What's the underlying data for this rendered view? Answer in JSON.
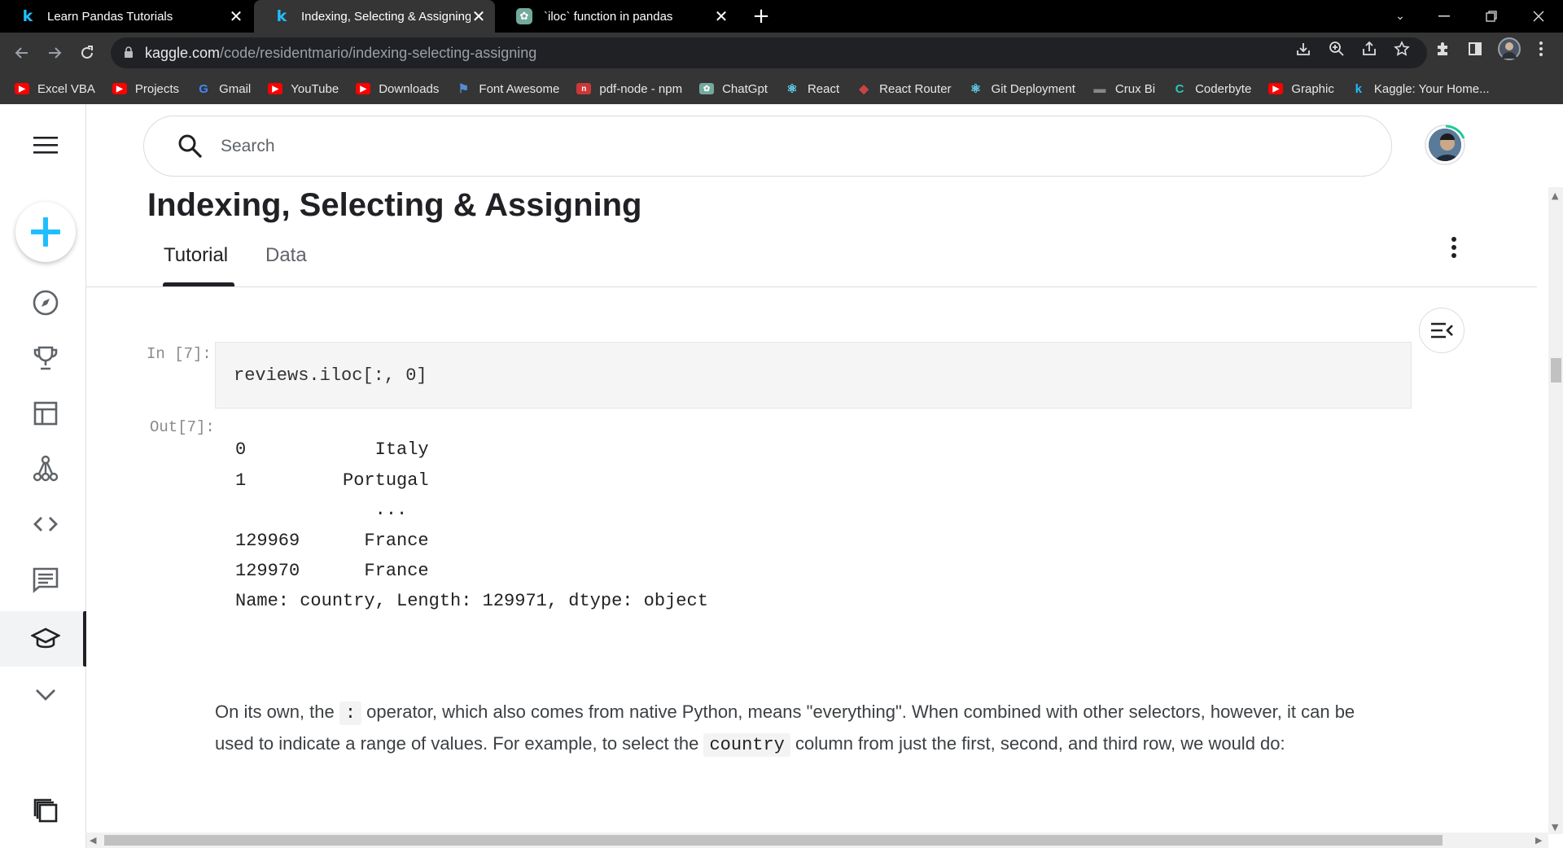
{
  "browser": {
    "tabs": [
      {
        "title": "Learn Pandas Tutorials",
        "close": "✕",
        "icon": "kaggle-icon"
      },
      {
        "title": "Indexing, Selecting & Assigning |",
        "close": "✕",
        "icon": "kaggle-icon"
      },
      {
        "title": "`iloc` function in pandas",
        "close": "✕",
        "icon": "chatgpt-icon"
      }
    ],
    "new_tab": "+",
    "url_domain": "kaggle.com",
    "url_path": "/code/residentmario/indexing-selecting-assigning",
    "bookmarks": [
      {
        "label": "Excel VBA",
        "color": "#ff0000",
        "icon": "youtube-icon"
      },
      {
        "label": "Projects",
        "color": "#ff0000",
        "icon": "youtube-icon"
      },
      {
        "label": "Gmail",
        "color": "#4285f4",
        "icon": "google-icon"
      },
      {
        "label": "YouTube",
        "color": "#ff0000",
        "icon": "youtube-icon"
      },
      {
        "label": "Downloads",
        "color": "#ff0000",
        "icon": "youtube-icon"
      },
      {
        "label": "Font Awesome",
        "color": "#538dd7",
        "icon": "flag-icon"
      },
      {
        "label": "pdf-node - npm",
        "color": "#cb3837",
        "icon": "npm-icon"
      },
      {
        "label": "ChatGpt",
        "color": "#74aa9c",
        "icon": "chatgpt-icon"
      },
      {
        "label": "React",
        "color": "#61dafb",
        "icon": "react-icon"
      },
      {
        "label": "React Router",
        "color": "#ca4245",
        "icon": "react-router-icon"
      },
      {
        "label": "Git Deployment",
        "color": "#61dafb",
        "icon": "react-icon"
      },
      {
        "label": "Crux Bi",
        "color": "#888888",
        "icon": "crux-icon"
      },
      {
        "label": "Coderbyte",
        "color": "#2ec4b6",
        "icon": "coderbyte-icon"
      },
      {
        "label": "Graphic",
        "color": "#ff0000",
        "icon": "youtube-icon"
      },
      {
        "label": "Kaggle: Your Home...",
        "color": "#20beff",
        "icon": "kaggle-icon"
      }
    ]
  },
  "search": {
    "placeholder": "Search"
  },
  "page": {
    "title": "Indexing, Selecting & Assigning",
    "tabs": [
      "Tutorial",
      "Data"
    ]
  },
  "cell": {
    "in_prompt": "In [7]:",
    "code": "reviews.iloc[:, 0]",
    "out_prompt": "Out[7]:",
    "output_lines": [
      "0            Italy",
      "1         Portugal",
      "             ...",
      "129969      France",
      "129970      France",
      "Name: country, Length: 129971, dtype: object"
    ]
  },
  "paragraph": {
    "part1": "On its own, the ",
    "code1": ":",
    "part2": " operator, which also comes from native Python, means \"everything\". When combined with other selectors, however, it can be used to indicate a range of values. For example, to select the ",
    "code2": "country",
    "part3": " column from just the first, second, and third row, we would do:"
  },
  "colors": {
    "kaggle_blue": "#20beff",
    "chrome_dark": "#353535"
  }
}
